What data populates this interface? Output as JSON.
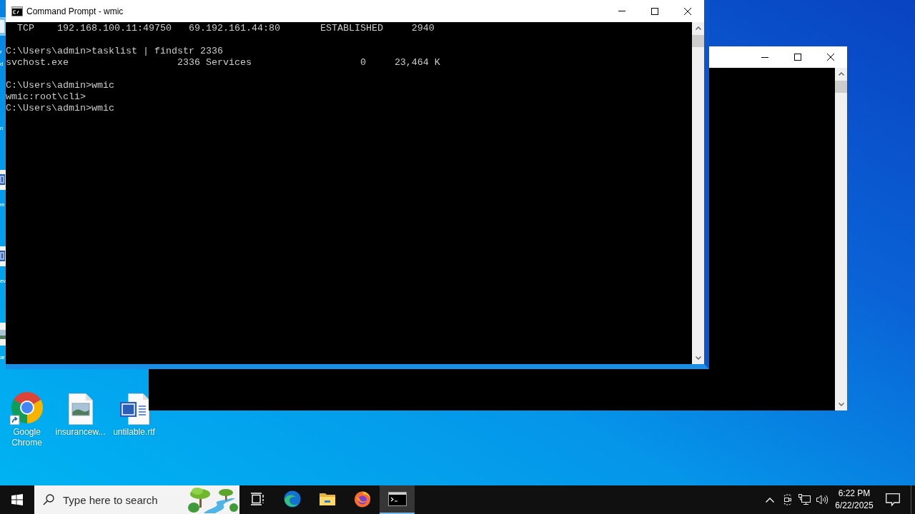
{
  "desktop": {
    "covered_icons": [
      {
        "kind": "app",
        "label": "r d"
      },
      {
        "kind": "blank",
        "label": "n"
      },
      {
        "kind": "word",
        "label": "re"
      },
      {
        "kind": "word",
        "label": "ev"
      },
      {
        "kind": "image",
        "label": "ar"
      }
    ],
    "icons": [
      {
        "kind": "chrome",
        "label": "Google Chrome"
      },
      {
        "kind": "image",
        "label": "insurancew..."
      },
      {
        "kind": "word",
        "label": "untilable.rtf"
      }
    ]
  },
  "window": {
    "title": "Command Prompt - wmic",
    "console": {
      "blocks": [
        {
          "lines": [
            "  TCP    192.168.100.11:49750   69.192.161.44:80       ESTABLISHED     2940"
          ]
        },
        {
          "lines": [
            "C:\\Users\\admin>tasklist | findstr 2336",
            "svchost.exe                   2336 Services                   0     23,464 K"
          ]
        },
        {
          "lines": [
            "C:\\Users\\admin>wmic",
            "wmic:root\\cli>",
            "C:\\Users\\admin>wmic"
          ]
        }
      ]
    }
  },
  "taskbar": {
    "search": {
      "placeholder": "Type here to search"
    },
    "buttons": [
      {
        "kind": "task_view",
        "selected": false
      },
      {
        "kind": "edge",
        "selected": false
      },
      {
        "kind": "explorer",
        "selected": false
      },
      {
        "kind": "firefox",
        "selected": false
      },
      {
        "kind": "console",
        "selected": true
      }
    ],
    "clock": {
      "time": "6:22 PM",
      "date": "6/22/2025"
    }
  }
}
